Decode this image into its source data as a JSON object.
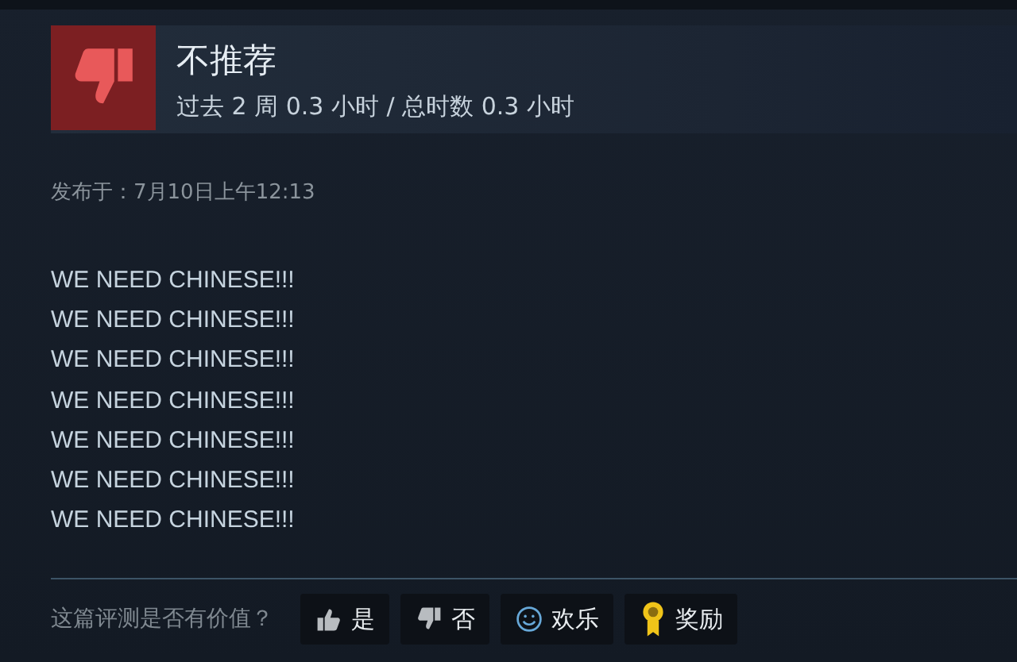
{
  "review": {
    "verdict": "不推荐",
    "playtime": "过去 2 周 0.3 小时 / 总时数 0.3 小时",
    "posted": "发布于：7月10日上午12:13",
    "lines": [
      "WE NEED CHINESE!!!",
      "WE NEED CHINESE!!!",
      "WE NEED CHINESE!!!",
      "WE NEED CHINESE!!!",
      "WE NEED CHINESE!!!",
      "WE NEED CHINESE!!!",
      "WE NEED CHINESE!!!"
    ]
  },
  "footer": {
    "question": "这篇评测是否有价值？",
    "buttons": [
      {
        "kind": "yes",
        "label": "是"
      },
      {
        "kind": "no",
        "label": "否"
      },
      {
        "kind": "funny",
        "label": "欢乐"
      },
      {
        "kind": "award",
        "label": "奖励"
      }
    ]
  }
}
